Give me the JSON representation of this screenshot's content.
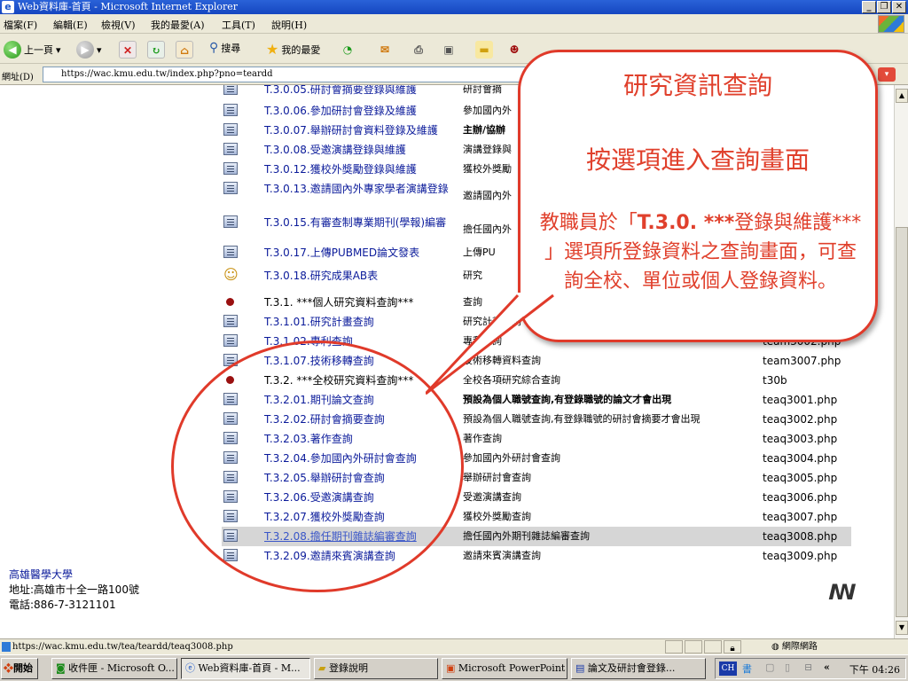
{
  "window": {
    "title": "Web資料庫-首頁 - Microsoft Internet Explorer"
  },
  "menu": [
    "檔案(F)",
    "編輯(E)",
    "檢視(V)",
    "我的最愛(A)",
    "工具(T)",
    "說明(H)"
  ],
  "toolbar": {
    "back": "上一頁",
    "search": "搜尋",
    "favorites": "我的最愛"
  },
  "address": {
    "label": "網址(D)",
    "url": "https://wac.kmu.edu.tw/index.php?pno=teardd"
  },
  "rows": [
    {
      "code": "T.3.0.05.研討會摘要登錄與維護",
      "desc": "研討會摘",
      "file": "",
      "icon": "doc"
    },
    {
      "code": "T.3.0.06.參加研討會登錄及維護",
      "desc": "參加國內外",
      "file": "",
      "icon": "doc"
    },
    {
      "code": "T.3.0.07.舉辦研討會資料登錄及維護",
      "desc": "主辦/協辦",
      "file": "",
      "icon": "doc"
    },
    {
      "code": "T.3.0.08.受邀演講登錄與維護",
      "desc": "演講登錄與",
      "file": "",
      "icon": "doc"
    },
    {
      "code": "T.3.0.12.獲校外獎勵登錄與維護",
      "desc": "獲校外獎勵",
      "file": "",
      "icon": "doc"
    },
    {
      "code": "T.3.0.13.邀請國內外專家學者演講登錄",
      "desc": "邀請國內外",
      "file": "",
      "icon": "doc"
    },
    {
      "code": "T.3.0.15.有審查制專業期刊(學報)編審",
      "desc": "擔任國內外",
      "file": "",
      "icon": "doc"
    },
    {
      "code": "T.3.0.17.上傳PUBMED論文發表",
      "desc": "上傳PU",
      "file": "",
      "icon": "doc"
    },
    {
      "code": "T.3.0.18.研究成果AB表",
      "desc": "研究",
      "file": "",
      "icon": "emoji"
    },
    {
      "code": "T.3.1. ***個人研究資料查詢***",
      "desc": "查詢",
      "file": "",
      "icon": "dot"
    },
    {
      "code": "T.3.1.01.研究計畫查詢",
      "desc": "研究計畫查詢",
      "file": "",
      "icon": "doc"
    },
    {
      "code": "T.3.1.02.專利查詢",
      "desc": "專利查詢",
      "file": "team3002.php",
      "icon": "doc"
    },
    {
      "code": "T.3.1.07.技術移轉查詢",
      "desc": "技術移轉資料查詢",
      "file": "team3007.php",
      "icon": "doc"
    },
    {
      "code": "T.3.2. ***全校研究資料查詢***",
      "desc": "全校各項研究綜合查詢",
      "file": "t30b",
      "icon": "dot"
    },
    {
      "code": "T.3.2.01.期刊論文查詢",
      "desc": "預設為個人職號查詢,有登錄職號的論文才會出現",
      "file": "teaq3001.php",
      "icon": "doc"
    },
    {
      "code": "T.3.2.02.研討會摘要查詢",
      "desc": "預設為個人職號查詢,有登錄職號的研討會摘要才會出現",
      "file": "teaq3002.php",
      "icon": "doc"
    },
    {
      "code": "T.3.2.03.著作查詢",
      "desc": "著作查詢",
      "file": "teaq3003.php",
      "icon": "doc"
    },
    {
      "code": "T.3.2.04.參加國內外研討會查詢",
      "desc": "參加國內外研討會查詢",
      "file": "teaq3004.php",
      "icon": "doc"
    },
    {
      "code": "T.3.2.05.舉辦研討會查詢",
      "desc": "舉辦研討會查詢",
      "file": "teaq3005.php",
      "icon": "doc"
    },
    {
      "code": "T.3.2.06.受邀演講查詢",
      "desc": "受邀演講查詢",
      "file": "teaq3006.php",
      "icon": "doc"
    },
    {
      "code": "T.3.2.07.獲校外獎勵查詢",
      "desc": "獲校外獎勵查詢",
      "file": "teaq3007.php",
      "icon": "doc"
    },
    {
      "code": "T.3.2.08.擔任期刊雜誌編審查詢",
      "desc": "擔任國內外期刊雜誌編審查詢",
      "file": "teaq3008.php",
      "icon": "doc"
    },
    {
      "code": "T.3.2.09.邀請來賓演講查詢",
      "desc": "邀請來賓演講查詢",
      "file": "teaq3009.php",
      "icon": "doc"
    }
  ],
  "footer": {
    "org": "高雄醫學大學",
    "address": "地址:高雄市十全一路100號",
    "phone": "電話:886-7-3121101"
  },
  "callout": {
    "title": "研究資訊查詢",
    "subtitle": "按選項進入查詢畫面",
    "body_pre": "教職員於「",
    "body_bold": "T.3.0. ***",
    "body_post": "登錄與維護*** 」選項所登錄資料之查詢畫面，可查詢全校、單位或個人登錄資料。"
  },
  "status": {
    "url": "https://wac.kmu.edu.tw/tea/teardd/teaq3008.php",
    "zone": "網際網路"
  },
  "taskbar": {
    "start": "開始",
    "tasks": [
      "收件匣 - Microsoft O...",
      "Web資料庫-首頁 - M...",
      "登錄說明",
      "Microsoft PowerPoint ...",
      "論文及研討會登錄..."
    ],
    "ime": "CH",
    "clock": "下午 04:26"
  },
  "colors": {
    "accent": "#e03a2a",
    "link": "#0a1a9a",
    "highlight": "#d6d6d6"
  }
}
